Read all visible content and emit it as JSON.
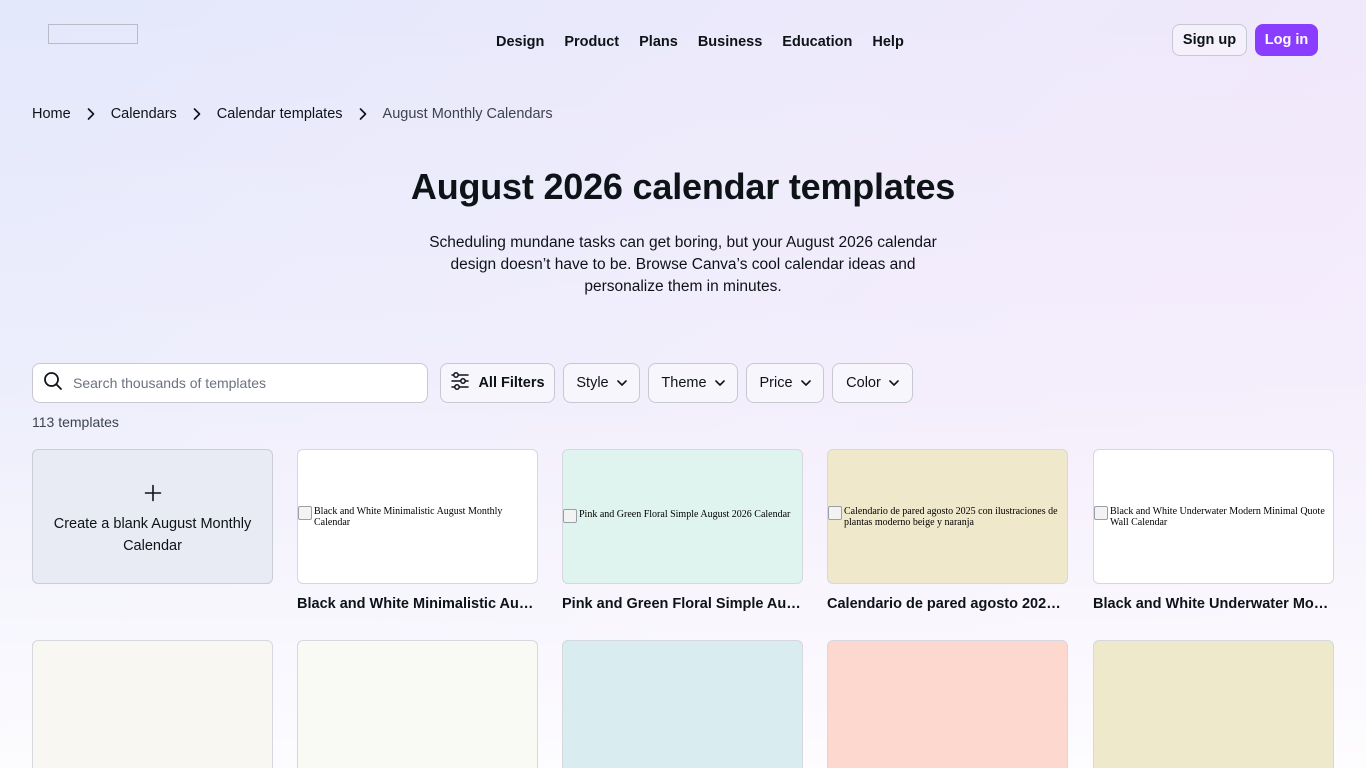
{
  "header": {
    "nav": [
      "Design",
      "Product",
      "Plans",
      "Business",
      "Education",
      "Help"
    ],
    "signup_label": "Sign up",
    "login_label": "Log in",
    "accent_color": "#8b3dff"
  },
  "breadcrumb": {
    "items": [
      "Home",
      "Calendars",
      "Calendar templates"
    ],
    "current": "August Monthly Calendars"
  },
  "hero": {
    "title": "August 2026 calendar templates",
    "subtitle": "Scheduling mundane tasks can get boring, but your August 2026 calendar design doesn’t have to be. Browse Canva’s cool calendar ideas and personalize them in minutes."
  },
  "filters": {
    "search_placeholder": "Search thousands of templates",
    "all_filters_label": "All Filters",
    "dropdowns": [
      "Style",
      "Theme",
      "Price",
      "Color"
    ]
  },
  "results": {
    "count_label": "113 templates"
  },
  "blank_card": {
    "icon": "plus-icon",
    "label": "Create a blank August Monthly Calendar"
  },
  "templates": [
    {
      "alt": "Black and White Minimalistic August Monthly Calendar",
      "title": "Black and White Minimalistic August Monthly Calendar",
      "bg": "#ffffff"
    },
    {
      "alt": "Pink and Green Floral Simple August 2026 Calendar",
      "title": "Pink and Green Floral Simple August 2026 Calendar",
      "bg": "#dff4ee"
    },
    {
      "alt": "Calendario de pared agosto 2025 con ilustraciones de plantas moderno beige y naranja",
      "title": "Calendario de pared agosto 2025 con ilustraciones de plantas moderno beige y naranja",
      "bg": "#efe8cb"
    },
    {
      "alt": "Black and White Underwater Modern Minimal Quote Wall Calendar",
      "title": "Black and White Underwater Modern Minimal Quote Wall Calendar",
      "bg": "#ffffff"
    }
  ],
  "second_row_colors": [
    "#f9f7f1",
    "#fafaf4",
    "#d9ecef",
    "#fcd8cf",
    "#efe9cc"
  ]
}
